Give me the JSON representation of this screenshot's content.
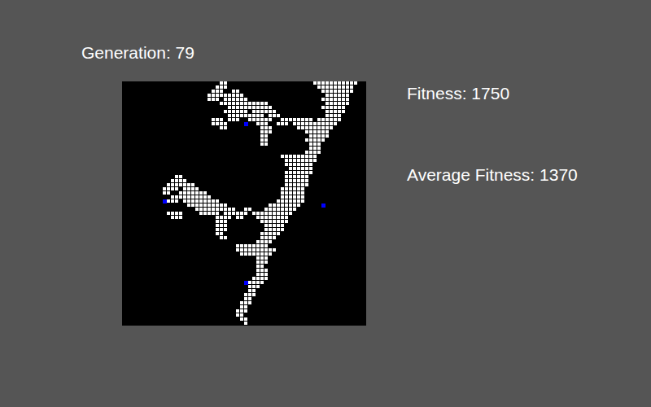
{
  "header": {
    "generation_label": "Generation: 79"
  },
  "stats": [
    {
      "label": "Fitness: 1750"
    },
    {
      "label": "Average Fitness: 1370"
    }
  ],
  "grid": {
    "rows": 60,
    "cols": 60,
    "runs": [
      [
        0,
        24,
        25
      ],
      [
        0,
        47,
        57
      ],
      [
        1,
        23,
        25
      ],
      [
        1,
        48,
        56
      ],
      [
        2,
        22,
        24
      ],
      [
        2,
        27,
        28
      ],
      [
        2,
        49,
        56
      ],
      [
        3,
        21,
        29
      ],
      [
        3,
        50,
        55
      ],
      [
        4,
        21,
        23
      ],
      [
        4,
        25,
        30
      ],
      [
        4,
        49,
        55
      ],
      [
        5,
        24,
        35
      ],
      [
        5,
        50,
        55
      ],
      [
        6,
        26,
        36
      ],
      [
        6,
        49,
        54
      ],
      [
        7,
        25,
        30
      ],
      [
        7,
        32,
        37
      ],
      [
        7,
        50,
        54
      ],
      [
        8,
        26,
        34
      ],
      [
        8,
        36,
        38
      ],
      [
        8,
        50,
        53
      ],
      [
        9,
        22,
        24
      ],
      [
        9,
        26,
        28
      ],
      [
        9,
        31,
        36
      ],
      [
        9,
        39,
        46
      ],
      [
        9,
        48,
        53
      ],
      [
        10,
        22,
        25
      ],
      [
        10,
        33,
        35
      ],
      [
        10,
        38,
        40
      ],
      [
        10,
        42,
        52
      ],
      [
        11,
        24,
        25
      ],
      [
        11,
        34,
        36
      ],
      [
        11,
        43,
        51
      ],
      [
        12,
        34,
        36
      ],
      [
        12,
        45,
        50
      ],
      [
        13,
        34,
        35
      ],
      [
        13,
        46,
        50
      ],
      [
        14,
        34,
        35
      ],
      [
        14,
        45,
        49
      ],
      [
        15,
        34,
        35
      ],
      [
        15,
        46,
        48
      ],
      [
        16,
        46,
        48
      ],
      [
        17,
        45,
        48
      ],
      [
        18,
        39,
        47
      ],
      [
        19,
        40,
        47
      ],
      [
        20,
        40,
        46
      ],
      [
        21,
        41,
        46
      ],
      [
        22,
        40,
        46
      ],
      [
        23,
        13,
        14
      ],
      [
        23,
        40,
        45
      ],
      [
        24,
        12,
        15
      ],
      [
        24,
        40,
        45
      ],
      [
        25,
        11,
        17
      ],
      [
        25,
        40,
        45
      ],
      [
        26,
        10,
        13
      ],
      [
        26,
        15,
        18
      ],
      [
        26,
        39,
        44
      ],
      [
        27,
        10,
        11
      ],
      [
        27,
        14,
        20
      ],
      [
        27,
        39,
        44
      ],
      [
        28,
        12,
        21
      ],
      [
        28,
        39,
        44
      ],
      [
        29,
        10,
        13
      ],
      [
        29,
        15,
        23
      ],
      [
        29,
        38,
        44
      ],
      [
        30,
        16,
        25
      ],
      [
        30,
        36,
        43
      ],
      [
        31,
        18,
        27
      ],
      [
        31,
        30,
        31
      ],
      [
        31,
        35,
        42
      ],
      [
        32,
        11,
        14
      ],
      [
        32,
        19,
        23
      ],
      [
        32,
        25,
        30
      ],
      [
        32,
        32,
        41
      ],
      [
        33,
        12,
        14
      ],
      [
        33,
        23,
        26
      ],
      [
        33,
        28,
        29
      ],
      [
        33,
        33,
        40
      ],
      [
        34,
        23,
        25
      ],
      [
        34,
        34,
        40
      ],
      [
        35,
        23,
        25
      ],
      [
        35,
        35,
        39
      ],
      [
        36,
        23,
        25
      ],
      [
        36,
        35,
        39
      ],
      [
        37,
        23,
        24
      ],
      [
        37,
        34,
        38
      ],
      [
        38,
        24,
        25
      ],
      [
        38,
        34,
        37
      ],
      [
        39,
        33,
        36
      ],
      [
        40,
        28,
        32
      ],
      [
        40,
        33,
        35
      ],
      [
        41,
        28,
        37
      ],
      [
        42,
        29,
        31
      ],
      [
        42,
        32,
        36
      ],
      [
        43,
        33,
        35
      ],
      [
        44,
        33,
        35
      ],
      [
        45,
        33,
        34
      ],
      [
        46,
        33,
        35
      ],
      [
        47,
        33,
        35
      ],
      [
        48,
        32,
        35
      ],
      [
        49,
        31,
        34
      ],
      [
        50,
        31,
        33
      ],
      [
        51,
        31,
        32
      ],
      [
        52,
        30,
        32
      ],
      [
        53,
        30,
        31
      ],
      [
        54,
        29,
        31
      ],
      [
        55,
        29,
        30
      ],
      [
        56,
        28,
        30
      ],
      [
        57,
        28,
        29
      ],
      [
        58,
        29,
        30
      ],
      [
        59,
        30,
        30
      ]
    ],
    "markers": [
      [
        10,
        30
      ],
      [
        29,
        10
      ],
      [
        30,
        49
      ],
      [
        49,
        30
      ]
    ]
  }
}
